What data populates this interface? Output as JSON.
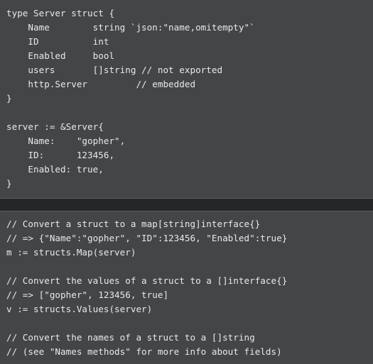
{
  "theme": {
    "background": "#434546",
    "text": "#e9e9e9",
    "divider_band": "#24272a",
    "divider_line": "#5c5e60"
  },
  "blocks": [
    {
      "id": "struct-definition",
      "language": "go",
      "lines": [
        "type Server struct {",
        "    Name        string `json:\"name,omitempty\"`",
        "    ID          int",
        "    Enabled     bool",
        "    users       []string // not exported",
        "    http.Server         // embedded",
        "}",
        "",
        "server := &Server{",
        "    Name:    \"gopher\",",
        "    ID:      123456,",
        "    Enabled: true,",
        "}"
      ]
    },
    {
      "id": "structs-usage",
      "language": "go",
      "lines": [
        "// Convert a struct to a map[string]interface{}",
        "// => {\"Name\":\"gopher\", \"ID\":123456, \"Enabled\":true}",
        "m := structs.Map(server)",
        "",
        "// Convert the values of a struct to a []interface{}",
        "// => [\"gopher\", 123456, true]",
        "v := structs.Values(server)",
        "",
        "// Convert the names of a struct to a []string",
        "// (see \"Names methods\" for more info about fields)"
      ]
    }
  ]
}
